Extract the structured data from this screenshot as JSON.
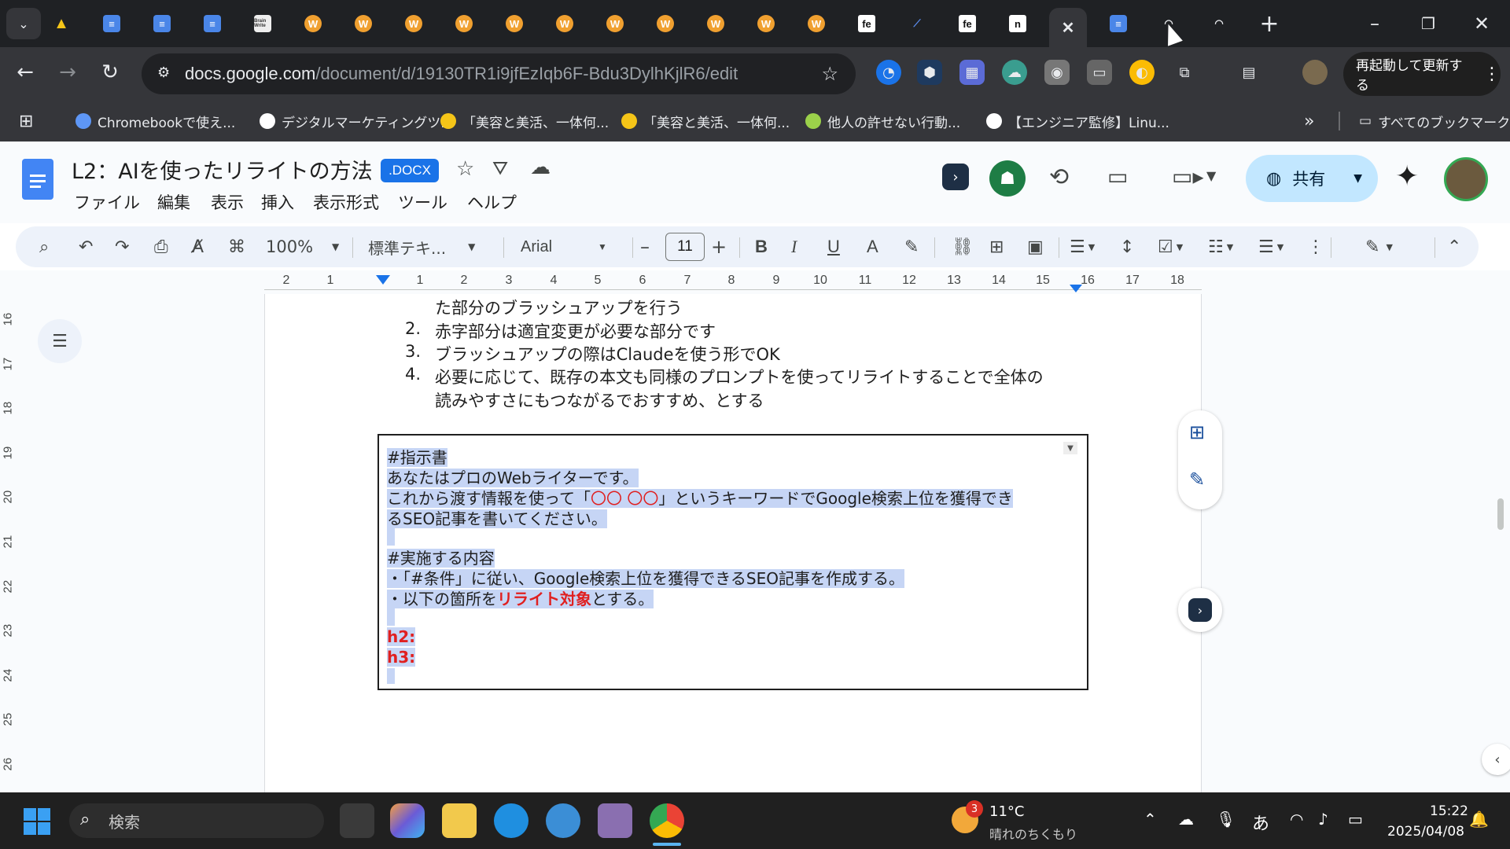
{
  "browser": {
    "tabs": [
      {
        "type": "drive"
      },
      {
        "type": "docs"
      },
      {
        "type": "docs"
      },
      {
        "type": "docs"
      },
      {
        "type": "image",
        "label": "Brain Write"
      },
      {
        "type": "w"
      },
      {
        "type": "w"
      },
      {
        "type": "w"
      },
      {
        "type": "w"
      },
      {
        "type": "w"
      },
      {
        "type": "w"
      },
      {
        "type": "w"
      },
      {
        "type": "w"
      },
      {
        "type": "w"
      },
      {
        "type": "w"
      },
      {
        "type": "w"
      },
      {
        "type": "fe",
        "label": "fe"
      },
      {
        "type": "chart"
      },
      {
        "type": "fe",
        "label": "fe"
      },
      {
        "type": "n",
        "label": "n"
      },
      {
        "type": "close",
        "active": true
      },
      {
        "type": "docs"
      },
      {
        "type": "arc"
      },
      {
        "type": "arc"
      }
    ],
    "new_tab_label": "+",
    "url_host": "docs.google.com",
    "url_path": "/document/d/19130TR1i9jfEzIqb6F-Bdu3DylhKjlR6/edit",
    "relaunch_label": "再起動して更新する",
    "bookmarks": [
      {
        "label": "Chromebookで使え...",
        "icon_color": "#5e97f6"
      },
      {
        "label": "デジタルマーケティングツ...",
        "icon_color": "#ffffff"
      },
      {
        "label": "「美容と美活、一体何...",
        "icon_color": "#f5c518"
      },
      {
        "label": "「美容と美活、一体何...",
        "icon_color": "#f5c518"
      },
      {
        "label": "他人の許せない行動...",
        "icon_color": "#9bd14a"
      },
      {
        "label": "【エンジニア監修】Linu...",
        "icon_color": "#ffffff"
      }
    ],
    "bookmarks_more": "»",
    "all_bookmarks_label": "すべてのブックマーク"
  },
  "docs": {
    "title": "L2：AIを使ったリライトの方法",
    "badge": ".DOCX",
    "menus": [
      "ファイル",
      "編集",
      "表示",
      "挿入",
      "表示形式",
      "ツール",
      "ヘルプ"
    ],
    "share_label": "共有",
    "toolbar": {
      "zoom": "100%",
      "style": "標準テキ...",
      "font": "Arial",
      "font_size": "11"
    },
    "ruler_h": [
      "2",
      "1",
      "1",
      "2",
      "3",
      "4",
      "5",
      "6",
      "7",
      "8",
      "9",
      "10",
      "11",
      "12",
      "13",
      "14",
      "15",
      "16",
      "17",
      "18"
    ],
    "ruler_v": [
      "16",
      "17",
      "18",
      "19",
      "20",
      "21",
      "22",
      "23",
      "24",
      "25",
      "26"
    ],
    "list_items": [
      {
        "num": "",
        "text": "た部分のブラッシュアップを行う"
      },
      {
        "num": "2.",
        "text": "赤字部分は適宜変更が必要な部分です"
      },
      {
        "num": "3.",
        "text": "ブラッシュアップの際はClaudeを使う形でOK"
      },
      {
        "num": "4.",
        "text": "必要に応じて、既存の本文も同様のプロンプトを使ってリライトすることで全体の"
      },
      {
        "num": "",
        "text": "読みやすさにもつながるでおすすめ、とする"
      }
    ],
    "prompt": {
      "l1": "#指示書",
      "l2": "あなたはプロのWebライターです。",
      "l3a": "これから渡す情報を使って「",
      "l3b": "〇〇 〇〇",
      "l3c": "」というキーワードでGoogle検索上位を獲得でき",
      "l4": "るSEO記事を書いてください。",
      "l5": "#実施する内容",
      "l6": "・「#条件」に従い、Google検索上位を獲得できるSEO記事を作成する。",
      "l7a": "・以下の箇所を",
      "l7b": "リライト対象",
      "l7c": "とする。",
      "l8": "h2:",
      "l9": "h3:"
    }
  },
  "taskbar": {
    "search_placeholder": "検索",
    "weather_badge": "3",
    "temperature": "11°C",
    "weather_text": "晴れのちくもり",
    "ime": "あ",
    "time": "15:22",
    "date": "2025/04/08"
  },
  "colors": {
    "accent": "#1a73e8",
    "highlight": "#c6d5f5",
    "red_text": "#e02020",
    "share_bg": "#c2e7ff"
  }
}
